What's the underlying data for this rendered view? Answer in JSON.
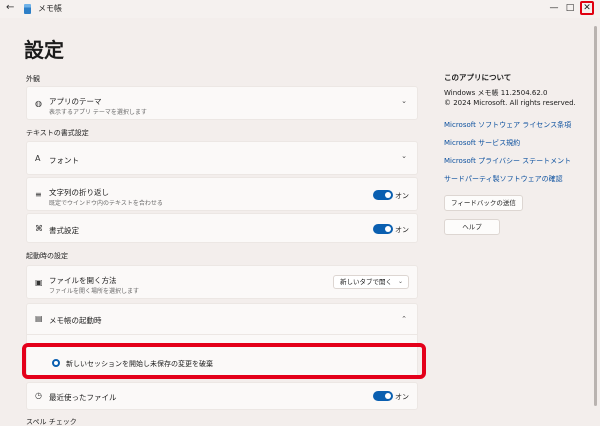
{
  "window": {
    "title": "メモ帳",
    "back_glyph": "←",
    "min_glyph": "—",
    "max_glyph": "□",
    "close_glyph": "✕"
  },
  "page": {
    "title": "設定"
  },
  "sections": {
    "appearance": "外観",
    "text_format": "テキストの書式設定",
    "startup": "起動時の設定",
    "spell": "スペル チェック"
  },
  "theme": {
    "label": "アプリのテーマ",
    "sub": "表示するアプリ テーマを選択します",
    "icon": "palette-icon",
    "chev": "⌄"
  },
  "font": {
    "label": "フォント",
    "icon": "font-icon",
    "chev": "⌄"
  },
  "word_wrap": {
    "label": "文字列の折り返し",
    "sub": "既定でウインドウ内のテキストを合わせる",
    "toggle_label": "オン",
    "icon": "wrap-icon"
  },
  "formatting": {
    "label": "書式設定",
    "toggle_label": "オン",
    "icon": "format-icon"
  },
  "open_file": {
    "label": "ファイルを開く方法",
    "sub": "ファイルを開く場所を選択します",
    "value": "新しいタブで開く",
    "icon": "open-file-icon"
  },
  "on_start": {
    "label": "メモ帳の起動時",
    "icon": "notepad-icon",
    "chev": "⌃",
    "option_selected": "新しいセッションを開始し未保存の変更を破棄"
  },
  "recent_files": {
    "label": "最近使ったファイル",
    "toggle_label": "オン",
    "icon": "history-icon"
  },
  "about": {
    "title": "このアプリについて",
    "version": "Windows メモ帳 11.2504.62.0",
    "copyright": "© 2024 Microsoft. All rights reserved.",
    "links": [
      "Microsoft ソフトウェア ライセンス条項",
      "Microsoft サービス規約",
      "Microsoft プライバシー ステートメント",
      "サードパーティ製ソフトウェアの確認"
    ],
    "feedback_button": "フィードバックの送信",
    "help_button": "ヘルプ"
  },
  "colors": {
    "accent": "#0a5fb0",
    "highlight": "#e4001a",
    "link": "#0a4f9e"
  }
}
